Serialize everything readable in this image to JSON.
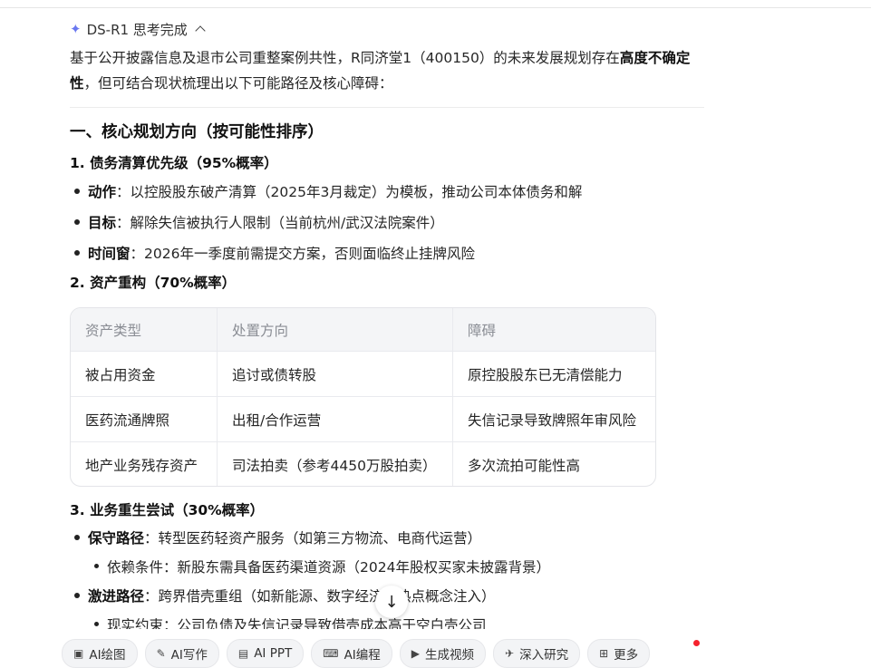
{
  "thinking": {
    "label": "DS-R1 思考完成"
  },
  "intro": {
    "part1": "基于公开披露信息及退市公司重整案例共性，R同济堂1（400150）的未来发展规划存在",
    "bold1": "高度不确定",
    "bold2": "性",
    "part2": "，但可结合现状梳理出以下可能路径及核心障碍："
  },
  "section1": {
    "title": "一、核心规划方向（按可能性排序）",
    "sub1": {
      "title": "1. 债务清算优先级（95%概率）",
      "items": [
        {
          "key": "动作",
          "text": "：以控股股东破产清算（2025年3月裁定）为模板，推动公司本体债务和解"
        },
        {
          "key": "目标",
          "text": "：解除失信被执行人限制（当前杭州/武汉法院案件）"
        },
        {
          "key": "时间窗",
          "text": "：2026年一季度前需提交方案，否则面临终止挂牌风险"
        }
      ]
    },
    "sub2": {
      "title": "2. 资产重构（70%概率）",
      "table": {
        "headers": [
          "资产类型",
          "处置方向",
          "障碍"
        ],
        "rows": [
          [
            "被占用资金",
            "追讨或债转股",
            "原控股股东已无清偿能力"
          ],
          [
            "医药流通牌照",
            "出租/合作运营",
            "失信记录导致牌照年审风险"
          ],
          [
            "地产业务残存资产",
            "司法拍卖（参考4450万股拍卖）",
            "多次流拍可能性高"
          ]
        ]
      }
    },
    "sub3": {
      "title": "3. 业务重生尝试（30%概率）",
      "items": [
        {
          "key": "保守路径",
          "text": "：转型医药轻资产服务（如第三方物流、电商代运营）"
        },
        {
          "sub": "依赖条件：新股东需具备医药渠道资源（2024年股权买家未披露背景）"
        },
        {
          "key": "激进路径",
          "text": "：跨界借壳重组（如新能源、数字经济等热点概念注入）"
        },
        {
          "sub": "现实约束：公司负债及失信记录导致借壳成本高于空白壳公司"
        }
      ]
    }
  },
  "toolbar": {
    "items": [
      {
        "label": "AI绘图",
        "icon": "image-icon"
      },
      {
        "label": "AI写作",
        "icon": "pen-icon"
      },
      {
        "label": "AI PPT",
        "icon": "ppt-icon"
      },
      {
        "label": "AI编程",
        "icon": "code-icon"
      },
      {
        "label": "生成视频",
        "icon": "video-icon"
      },
      {
        "label": "深入研究",
        "icon": "research-icon"
      },
      {
        "label": "更多",
        "icon": "more-icon"
      }
    ]
  },
  "colors": {
    "accent": "#6a78f0",
    "notification": "#f5222d"
  }
}
